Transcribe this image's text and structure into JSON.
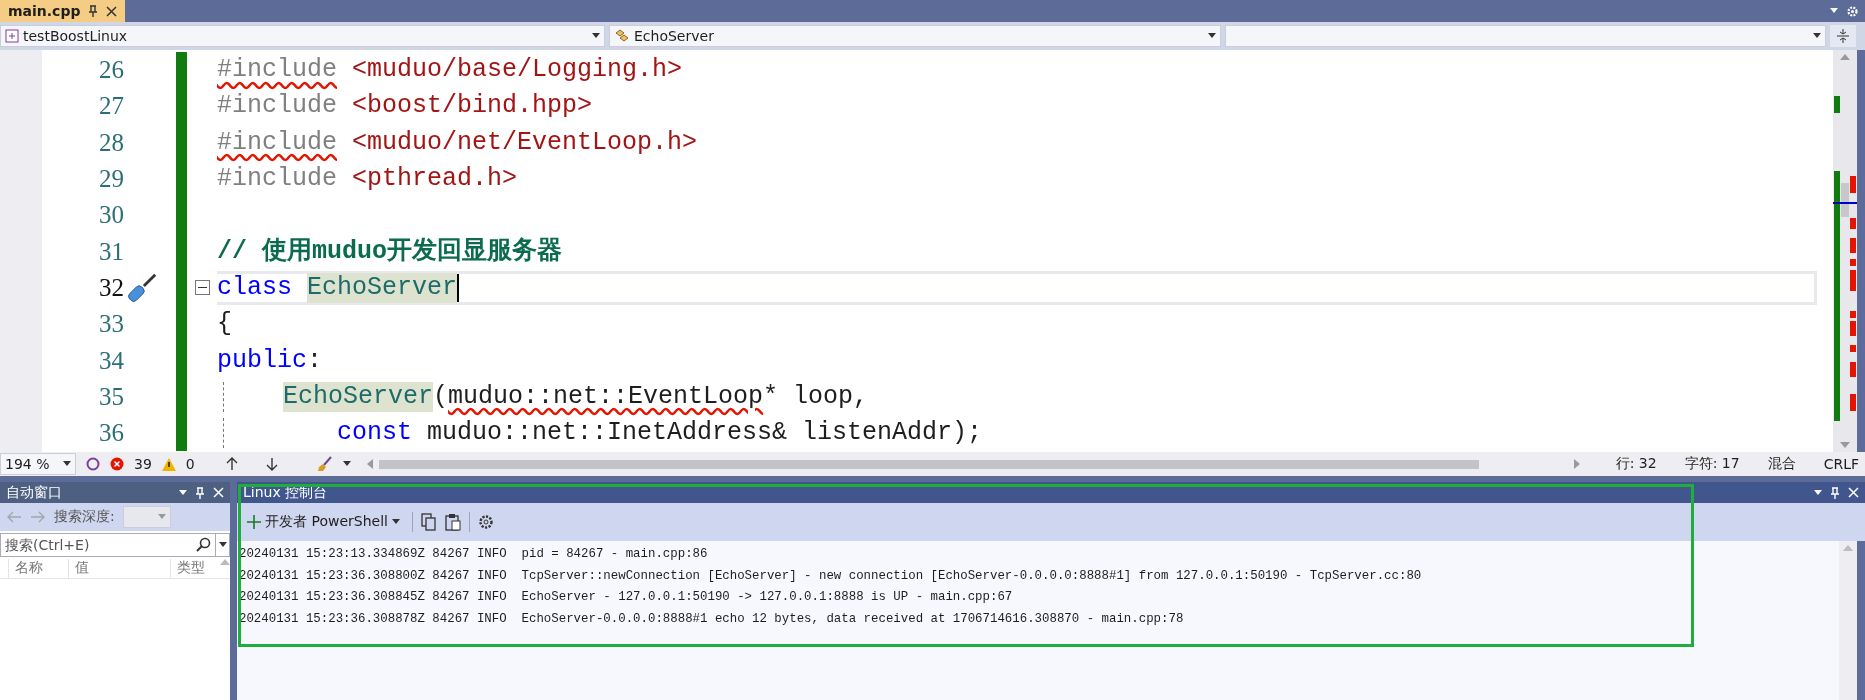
{
  "editor_tab": {
    "title": "main.cpp",
    "selected": true
  },
  "nav_bar": {
    "project": "testBoostLinux",
    "scope": "EchoServer"
  },
  "editor": {
    "lines": [
      {
        "number": "26",
        "current": false,
        "tokens": [
          {
            "kind": "preproc",
            "text": "#include",
            "squiggle": true
          },
          {
            "kind": "string",
            "text": " <muduo/base/Logging.h>"
          }
        ]
      },
      {
        "number": "27",
        "current": false,
        "tokens": [
          {
            "kind": "preproc",
            "text": "#include"
          },
          {
            "kind": "string",
            "text": " <boost/bind.hpp>"
          }
        ]
      },
      {
        "number": "28",
        "current": false,
        "tokens": [
          {
            "kind": "preproc",
            "text": "#include",
            "squiggle": true
          },
          {
            "kind": "string",
            "text": " <muduo/net/EventLoop.h>"
          }
        ]
      },
      {
        "number": "29",
        "current": false,
        "tokens": [
          {
            "kind": "preproc",
            "text": "#include"
          },
          {
            "kind": "string",
            "text": " <pthread.h>"
          }
        ]
      },
      {
        "number": "30",
        "current": false
      },
      {
        "number": "31",
        "current": false,
        "tokens": [
          {
            "kind": "comment",
            "text": "// 使用muduo开发回显服务器"
          }
        ]
      },
      {
        "number": "32",
        "current": true,
        "quick_action": true,
        "collapsed": false,
        "tokens": [
          {
            "kind": "keyword",
            "text": "class "
          },
          {
            "kind": "type",
            "text": "EchoServer",
            "highlight": true
          }
        ]
      },
      {
        "number": "33",
        "current": false,
        "tokens": [
          {
            "kind": "plain",
            "text": "{"
          }
        ]
      },
      {
        "number": "34",
        "current": false,
        "tokens": [
          {
            "kind": "keyword",
            "text": "public"
          },
          {
            "kind": "plain",
            "text": ":"
          }
        ]
      },
      {
        "number": "35",
        "current": false,
        "tokens": [
          {
            "kind": "indent"
          },
          {
            "kind": "type",
            "text": "EchoServer",
            "highlight": true
          },
          {
            "kind": "plain",
            "text": "("
          },
          {
            "kind": "plain",
            "text": "muduo::net::EventLoop",
            "squiggle": true
          },
          {
            "kind": "plain",
            "text": "* loop,"
          }
        ]
      },
      {
        "number": "36",
        "current": false,
        "tokens": [
          {
            "kind": "indent"
          },
          {
            "kind": "indent"
          },
          {
            "kind": "keyword",
            "text": "const"
          },
          {
            "kind": "plain",
            "text": " muduo::net::InetAddress& listenAddr);"
          }
        ]
      }
    ]
  },
  "status_bar": {
    "zoom": "194 %",
    "errors": "39",
    "warnings": "0",
    "line": "行: 32",
    "column": "字符: 17",
    "indent": "混合",
    "line_ending": "CRLF"
  },
  "auto_window": {
    "title": "自动窗口",
    "depth_label": "搜索深度:",
    "search_placeholder": "搜索(Ctrl+E)",
    "columns": [
      "名称",
      "值",
      "类型"
    ]
  },
  "console": {
    "title": "Linux 控制台",
    "shell": "开发者 PowerShell",
    "lines": [
      "20240131 15:23:13.334869Z 84267 INFO  pid = 84267 - main.cpp:86",
      "20240131 15:23:36.308800Z 84267 INFO  TcpServer::newConnection [EchoServer] - new connection [EchoServer-0.0.0.0:8888#1] from 127.0.0.1:50190 - TcpServer.cc:80",
      "20240131 15:23:36.308845Z 84267 INFO  EchoServer - 127.0.0.1:50190 -> 127.0.0.1:8888 is UP - main.cpp:67",
      "20240131 15:23:36.308878Z 84267 INFO  EchoServer-0.0.0.0:8888#1 echo 12 bytes, data received at 1706714616.308870 - main.cpp:78"
    ]
  }
}
